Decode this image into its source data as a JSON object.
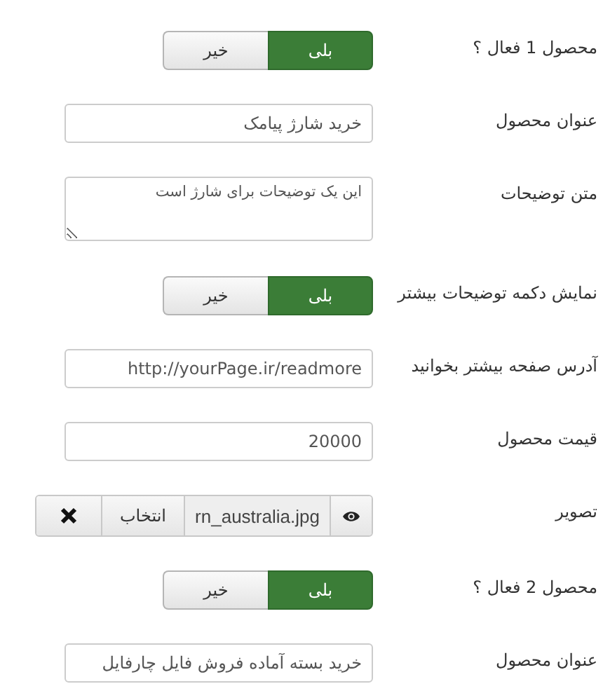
{
  "fields": [
    {
      "kind": "toggle",
      "label": "محصول 1 فعال ؟",
      "options": [
        {
          "label": "بلی",
          "selected": true
        },
        {
          "label": "خیر",
          "selected": false
        }
      ]
    },
    {
      "kind": "text",
      "label": "عنوان محصول",
      "value": "خرید شارژ پیامک"
    },
    {
      "kind": "textarea",
      "label": "متن توضیحات",
      "value": "این یک توضیحات برای شارژ است"
    },
    {
      "kind": "toggle",
      "label": "نمایش دکمه توضیحات بیشتر",
      "options": [
        {
          "label": "بلی",
          "selected": true
        },
        {
          "label": "خیر",
          "selected": false
        }
      ]
    },
    {
      "kind": "text",
      "label": "آدرس صفحه بیشتر بخوانید",
      "value": "http://yourPage.ir/readmore"
    },
    {
      "kind": "text",
      "label": "قیمت محصول",
      "value": "20000"
    },
    {
      "kind": "media",
      "label": "تصویر",
      "value": "rn_australia.jpg",
      "button": "انتخاب"
    },
    {
      "kind": "toggle",
      "label": "محصول 2 فعال ؟",
      "options": [
        {
          "label": "بلی",
          "selected": true
        },
        {
          "label": "خیر",
          "selected": false
        }
      ]
    },
    {
      "kind": "text",
      "label": "عنوان محصول",
      "value": "خرید بسته آماده فروش فایل چارفایل"
    }
  ]
}
